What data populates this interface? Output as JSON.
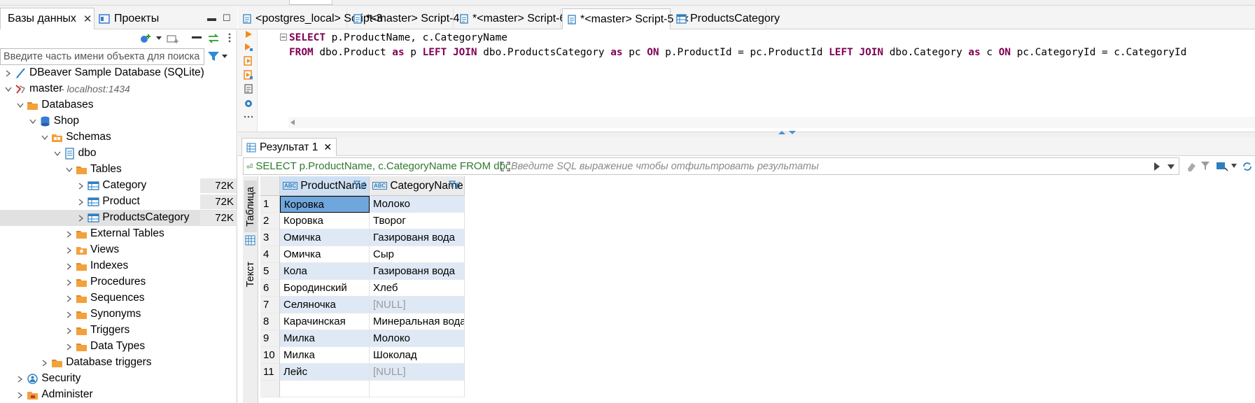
{
  "left_panel": {
    "tabs": [
      {
        "label": "Базы данных",
        "active": true
      },
      {
        "label": "Проекты",
        "active": false
      }
    ],
    "search_placeholder": "Введите часть имени объекта для поиска",
    "tree": [
      {
        "label": "DBeaver Sample Database (SQLite)",
        "level": 0,
        "expanded": false,
        "icon": "sqlite-db-icon"
      },
      {
        "label": "master",
        "sub": " - localhost:1434",
        "level": 0,
        "expanded": true,
        "icon": "sqlserver-icon"
      },
      {
        "label": "Databases",
        "level": 1,
        "expanded": true,
        "icon": "folder-icon"
      },
      {
        "label": "Shop",
        "level": 2,
        "expanded": true,
        "icon": "database-icon"
      },
      {
        "label": "Schemas",
        "level": 3,
        "expanded": true,
        "icon": "schemas-icon"
      },
      {
        "label": "dbo",
        "level": 4,
        "expanded": true,
        "icon": "schema-icon"
      },
      {
        "label": "Tables",
        "level": 5,
        "expanded": true,
        "icon": "folder-icon"
      },
      {
        "label": "Category",
        "level": 6,
        "expanded": false,
        "icon": "table-icon",
        "size": "72K"
      },
      {
        "label": "Product",
        "level": 6,
        "expanded": false,
        "icon": "table-icon",
        "size": "72K"
      },
      {
        "label": "ProductsCategory",
        "level": 6,
        "expanded": false,
        "icon": "table-icon",
        "size": "72K",
        "selected": true
      },
      {
        "label": "External Tables",
        "level": 5,
        "expanded": false,
        "icon": "folder-icon"
      },
      {
        "label": "Views",
        "level": 5,
        "expanded": false,
        "icon": "views-icon"
      },
      {
        "label": "Indexes",
        "level": 5,
        "expanded": false,
        "icon": "folder-icon"
      },
      {
        "label": "Procedures",
        "level": 5,
        "expanded": false,
        "icon": "folder-icon"
      },
      {
        "label": "Sequences",
        "level": 5,
        "expanded": false,
        "icon": "folder-icon"
      },
      {
        "label": "Synonyms",
        "level": 5,
        "expanded": false,
        "icon": "folder-icon"
      },
      {
        "label": "Triggers",
        "level": 5,
        "expanded": false,
        "icon": "folder-icon"
      },
      {
        "label": "Data Types",
        "level": 5,
        "expanded": false,
        "icon": "folder-icon"
      },
      {
        "label": "Database triggers",
        "level": 3,
        "expanded": false,
        "icon": "folder-icon"
      },
      {
        "label": "Security",
        "level": 1,
        "expanded": false,
        "icon": "security-icon"
      },
      {
        "label": "Administer",
        "level": 1,
        "expanded": false,
        "icon": "administer-icon"
      }
    ]
  },
  "editor_tabs": [
    {
      "label": "<postgres_local> Script-3",
      "active": false,
      "closable": false
    },
    {
      "label": "*<master> Script-4",
      "active": false,
      "closable": false
    },
    {
      "label": "*<master> Script-6",
      "active": false,
      "closable": false
    },
    {
      "label": "*<master> Script-5",
      "active": true,
      "closable": true
    },
    {
      "label": "ProductsCategory",
      "active": false,
      "closable": false,
      "icon": "table-icon"
    }
  ],
  "editor": {
    "line1": [
      {
        "t": "SELECT",
        "kw": true
      },
      {
        "t": " p.ProductName, c.CategoryName",
        "kw": false
      }
    ],
    "line2": [
      {
        "t": "FROM",
        "kw": true
      },
      {
        "t": " dbo.Product ",
        "kw": false
      },
      {
        "t": "as",
        "kw": true
      },
      {
        "t": " p ",
        "kw": false
      },
      {
        "t": "LEFT JOIN",
        "kw": true
      },
      {
        "t": " dbo.ProductsCategory ",
        "kw": false
      },
      {
        "t": "as",
        "kw": true
      },
      {
        "t": " pc ",
        "kw": false
      },
      {
        "t": "ON",
        "kw": true
      },
      {
        "t": " p.ProductId = pc.ProductId ",
        "kw": false
      },
      {
        "t": "LEFT JOIN",
        "kw": true
      },
      {
        "t": " dbo.Category ",
        "kw": false
      },
      {
        "t": "as",
        "kw": true
      },
      {
        "t": " c ",
        "kw": false
      },
      {
        "t": "ON",
        "kw": true
      },
      {
        "t": " pc.CategoryId = c.CategoryId",
        "kw": false
      }
    ]
  },
  "results": {
    "tab_label": "Результат 1",
    "query_text": "SELECT p.ProductName, c.CategoryName FROM dbo.P",
    "filter_placeholder": "Введите SQL выражение чтобы отфильтровать результаты",
    "side_tabs": {
      "table": "Таблица",
      "text": "Текст"
    },
    "columns": [
      "ProductName",
      "CategoryName"
    ],
    "column_type_badge": "ABC",
    "rows": [
      [
        "Коровка",
        "Молоко"
      ],
      [
        "Коровка",
        "Творог"
      ],
      [
        "Омичка",
        "Газированя вода"
      ],
      [
        "Омичка",
        "Сыр"
      ],
      [
        "Кола",
        "Газированя вода"
      ],
      [
        "Бородинский",
        "Хлеб"
      ],
      [
        "Селяночка",
        "[NULL]"
      ],
      [
        "Карачинская",
        "Минеральная вода"
      ],
      [
        "Милка",
        "Молоко"
      ],
      [
        "Милка",
        "Шоколад"
      ],
      [
        "Лейс",
        "[NULL]"
      ]
    ]
  },
  "colors": {
    "keyword": "#7f0055",
    "selection": "#6fa6dc",
    "alt_row": "#dfe9f5",
    "folder": "#f2a13b",
    "query_green": "#2f7a2f"
  }
}
